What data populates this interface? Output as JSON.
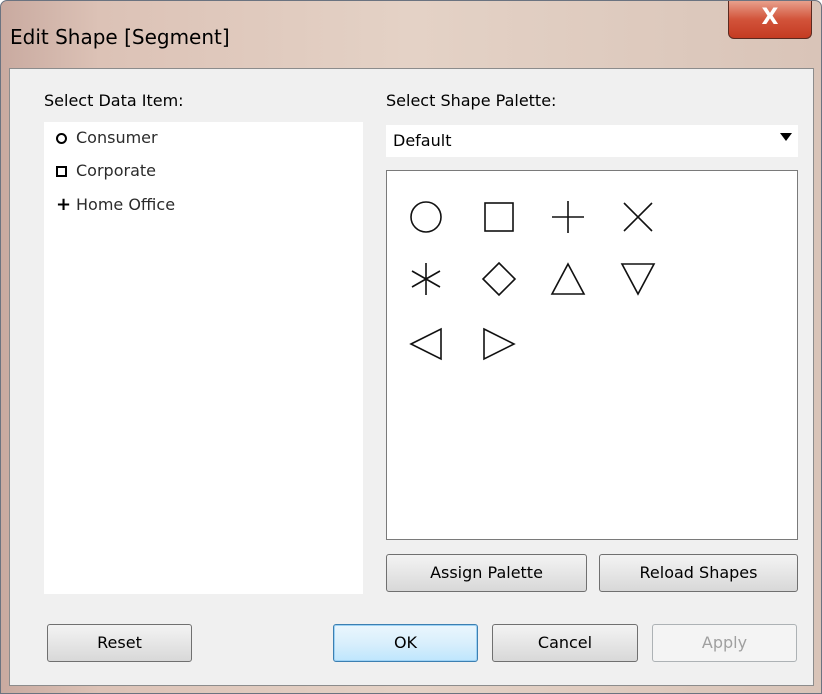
{
  "window": {
    "title": "Edit Shape [Segment]",
    "close_glyph": "X"
  },
  "left": {
    "label": "Select Data Item:",
    "items": [
      {
        "label": "Consumer",
        "shape": "circle"
      },
      {
        "label": "Corporate",
        "shape": "square"
      },
      {
        "label": "Home Office",
        "shape": "plus"
      }
    ]
  },
  "right": {
    "label": "Select Shape Palette:",
    "palette_value": "Default",
    "shapes": [
      "circle",
      "square",
      "plus",
      "times",
      "asterisk",
      "diamond",
      "triangle-up",
      "triangle-down",
      "triangle-left",
      "triangle-right"
    ]
  },
  "buttons": {
    "assign_palette": "Assign Palette",
    "reload_shapes": "Reload Shapes",
    "reset": "Reset",
    "ok": "OK",
    "cancel": "Cancel",
    "apply": "Apply"
  }
}
